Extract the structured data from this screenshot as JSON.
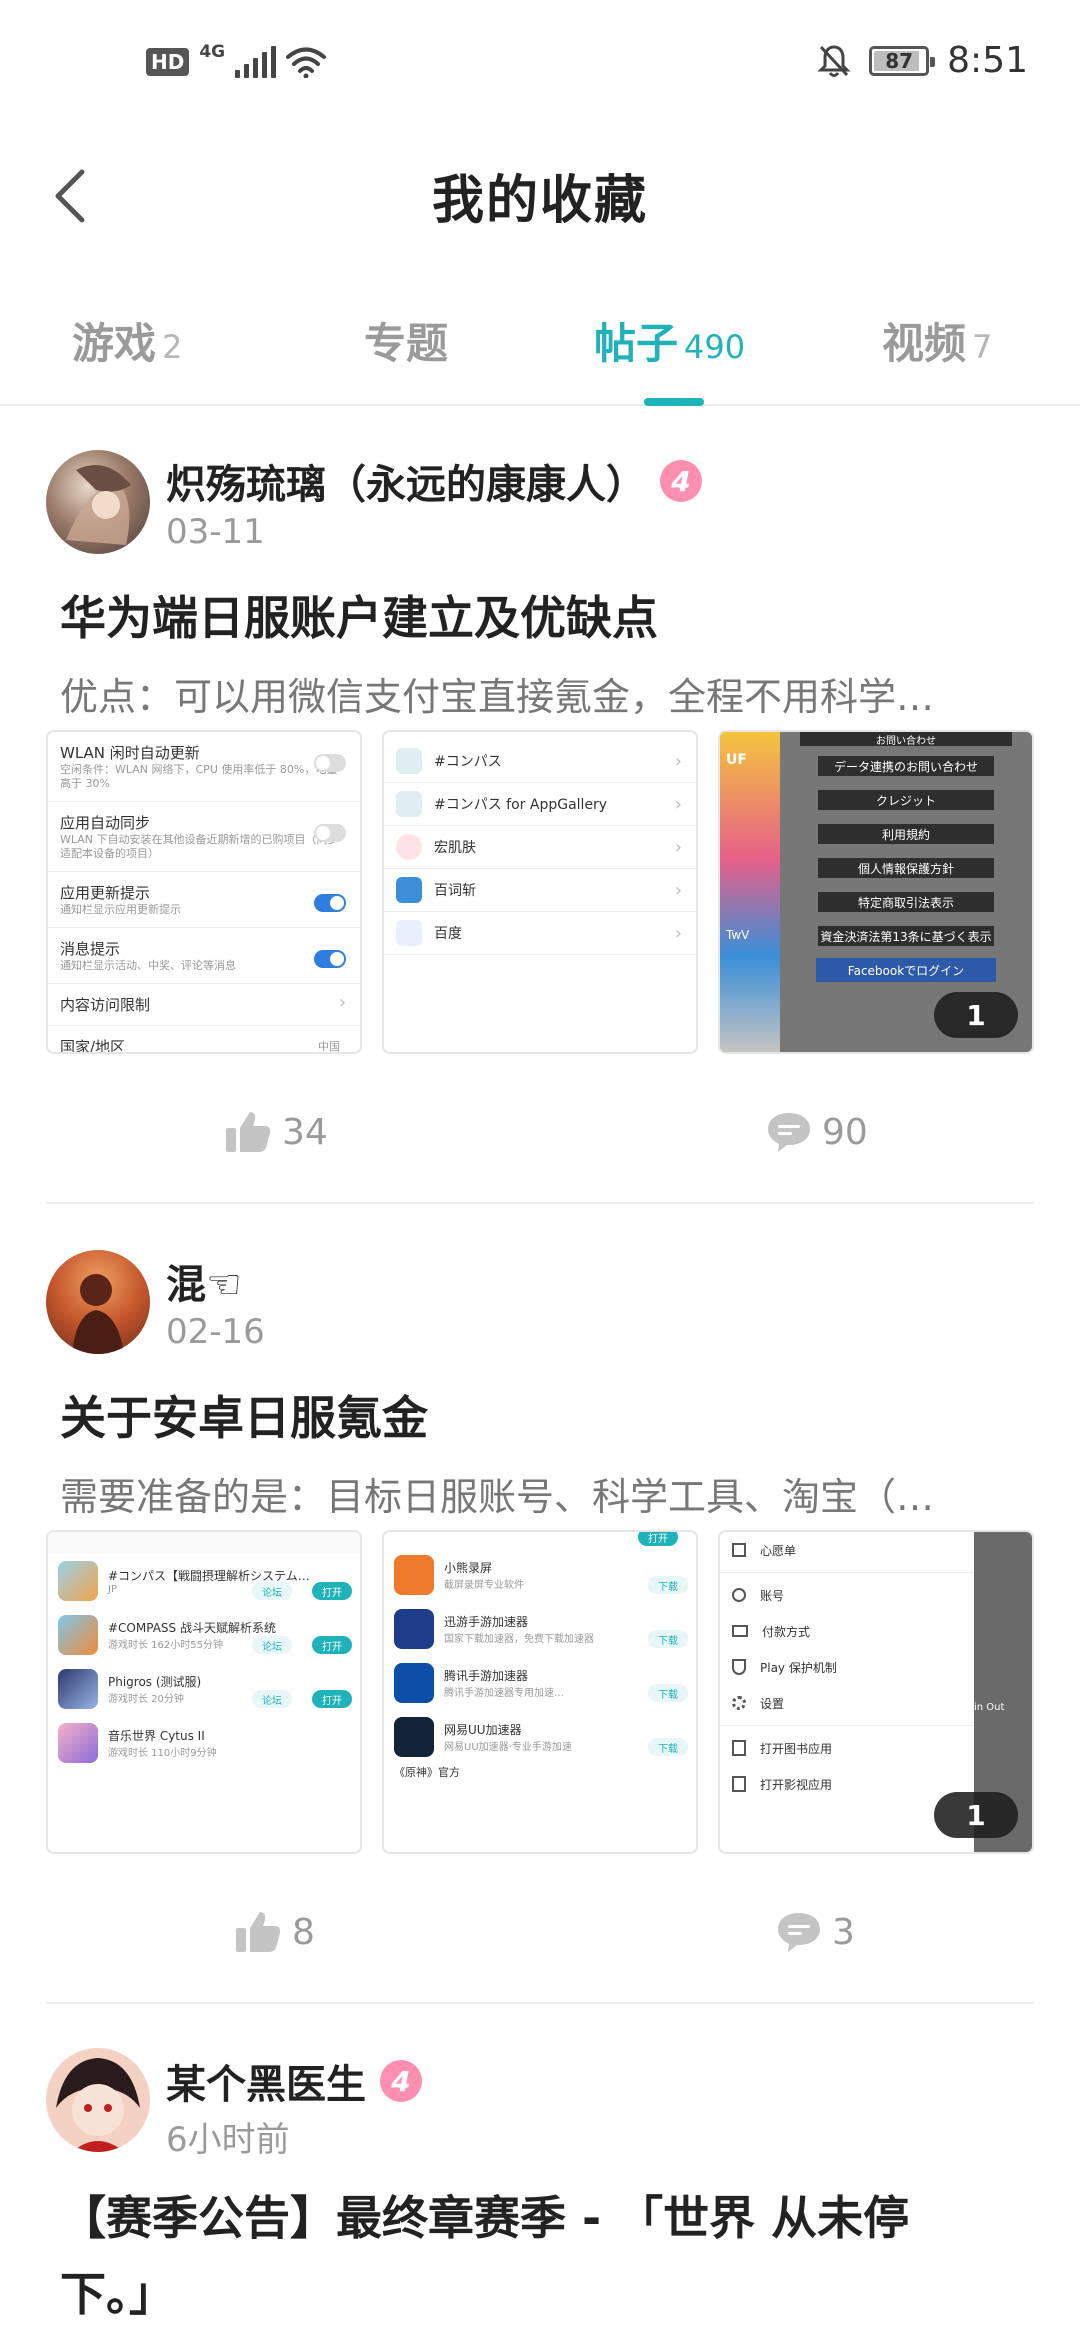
{
  "status_bar": {
    "hd": "HD",
    "network": "4G",
    "battery_level": 87,
    "battery_label": "87",
    "time": "8:51"
  },
  "header": {
    "title": "我的收藏",
    "back_icon": "chevron-left-icon"
  },
  "tabs": [
    {
      "label": "游戏",
      "count": "2",
      "active": false
    },
    {
      "label": "专题",
      "count": "",
      "active": false
    },
    {
      "label": "帖子",
      "count": "490",
      "active": true
    },
    {
      "label": "视频",
      "count": "7",
      "active": false
    }
  ],
  "posts": [
    {
      "author": "炽殇琉璃（永远的康康人）",
      "level": "4",
      "date": "03-11",
      "title": "华为端日服账户建立及优缺点",
      "excerpt": "优点：可以用微信支付宝直接氪金，全程不用科学…",
      "extra_images": "1",
      "likes": "34",
      "comments": "90",
      "settings_rows": [
        {
          "t": "WLAN 闲时自动更新",
          "s": "空闲条件：WLAN 网络下，CPU 使用率低于 80%，电量高于 30%"
        },
        {
          "t": "应用自动同步",
          "s": "WLAN 下自动安装在其他设备近期新增的已购项目（同步适配本设备的项目）"
        },
        {
          "t": "应用更新提示",
          "s": "通知栏显示应用更新提示"
        },
        {
          "t": "消息提示",
          "s": "通知栏显示活动、中奖、评论等消息"
        },
        {
          "t": "内容访问限制",
          "s": ""
        },
        {
          "t": "国家/地区",
          "s": ""
        }
      ],
      "settings_region_value": "中国",
      "app_list": [
        "#コンパス",
        "#コンパス for AppGallery",
        "宏肌肤",
        "百词斩",
        "百度"
      ],
      "jp_menu": [
        "データ連携のお問い合わせ",
        "クレジット",
        "利用規約",
        "個人情報保護方針",
        "特定商取引法表示",
        "資金決済法第13条に基づく表示"
      ],
      "jp_menu_top": "お問い合わせ",
      "jp_menu_fb": "Facebookでログイン",
      "jp_side": [
        "UF",
        "TwV"
      ]
    },
    {
      "author": "混☜",
      "level": "",
      "date": "02-16",
      "title": "关于安卓日服氪金",
      "excerpt": "需要准备的是：目标日服账号、科学工具、淘宝（…",
      "extra_images": "1",
      "likes": "8",
      "comments": "3",
      "game_list": [
        {
          "t": "#コンパス【戦闘摂理解析システム…",
          "s": "JP"
        },
        {
          "t": "#COMPASS 战斗天赋解析系统",
          "s": "游戏时长 162小时55分钟"
        },
        {
          "t": "Phigros (测试服)",
          "s": "游戏时长 20分钟"
        },
        {
          "t": "音乐世界 Cytus II",
          "s": "游戏时长 110小时9分钟"
        }
      ],
      "game_btn_forum": "论坛",
      "game_btn_open": "打开",
      "accel_list": [
        {
          "t": "小熊录屏",
          "s": "截屏录屏专业软件"
        },
        {
          "t": "迅游手游加速器",
          "s": "国家下载加速器，免费下载加速器"
        },
        {
          "t": "腾讯手游加速器",
          "s": "腾讯手游加速器专用加速…"
        },
        {
          "t": "网易UU加速器",
          "s": "网易UU加速器·专业手游加速"
        },
        {
          "t": "《原神》官方",
          "s": ""
        }
      ],
      "accel_btn": "下载",
      "accel_top_btn": "打开",
      "menu_top": "心愿单",
      "menu_list": [
        "账号",
        "付款方式",
        "Play 保护机制",
        "设置",
        "打开图书应用",
        "打开影视应用"
      ],
      "menu_side": "in Out"
    },
    {
      "author": "某个黑医生",
      "level": "4",
      "date": "6小时前",
      "title": "【赛季公告】最终章赛季 - 「世界 从未停下。」"
    }
  ],
  "colors": {
    "accent": "#1fb2b8",
    "level_badge": "#ff8fb0",
    "muted": "#9a9a9a"
  }
}
